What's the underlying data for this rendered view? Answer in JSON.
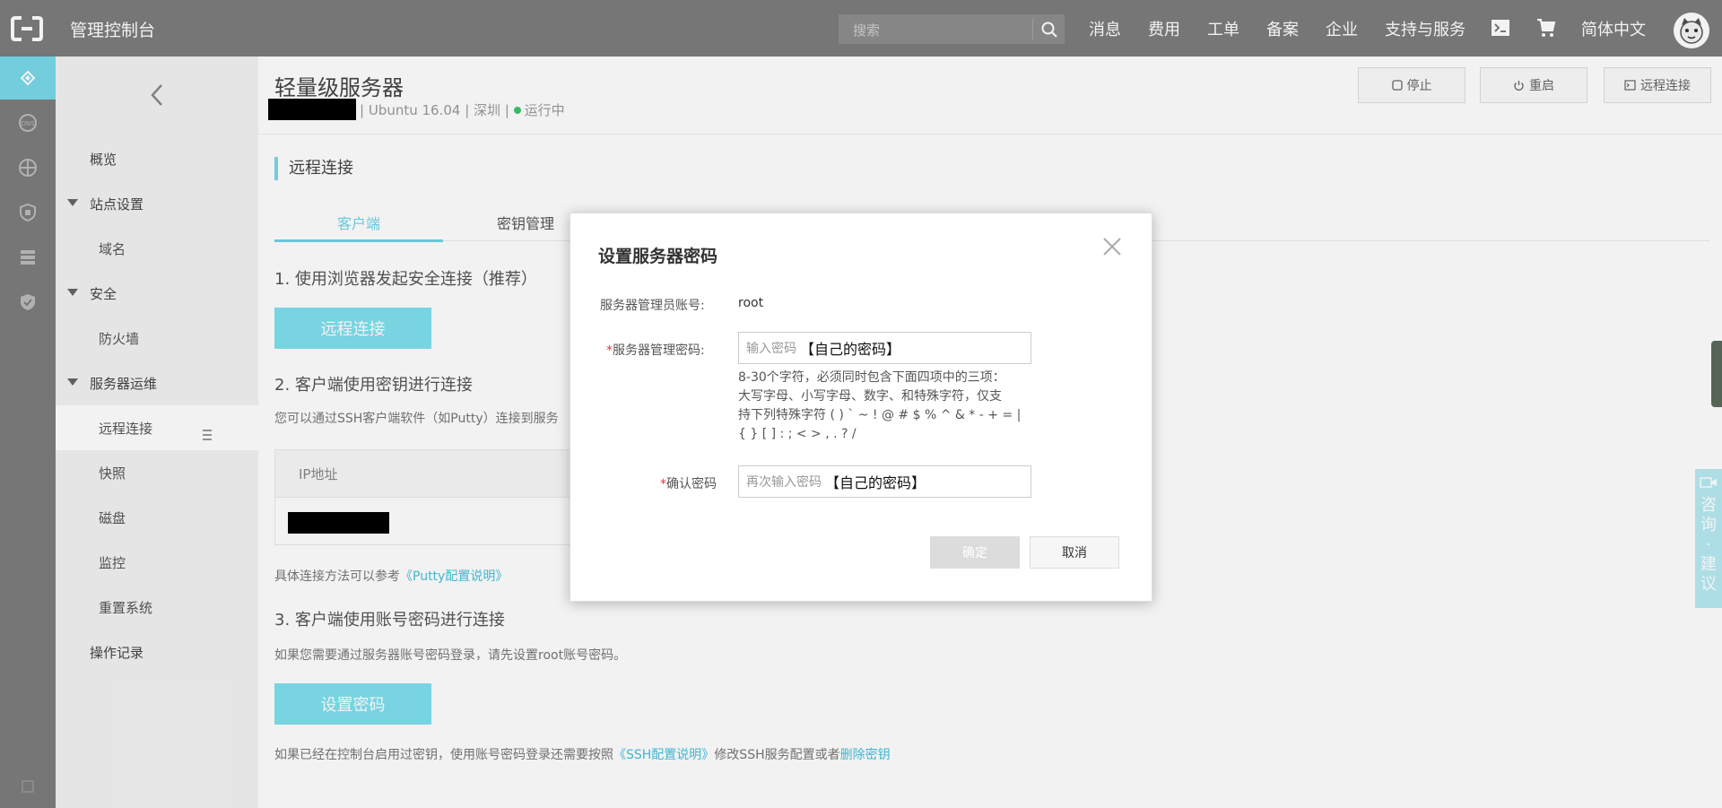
{
  "topbar": {
    "brand": "管理控制台",
    "search_placeholder": "搜索",
    "nav": [
      "消息",
      "费用",
      "工单",
      "备案",
      "企业",
      "支持与服务"
    ],
    "language": "简体中文"
  },
  "leftnav": {
    "items": [
      {
        "label": "概览"
      },
      {
        "label": "站点设置"
      },
      {
        "label": "域名"
      },
      {
        "label": "安全"
      },
      {
        "label": "防火墙"
      },
      {
        "label": "服务器运维"
      },
      {
        "label": "远程连接"
      },
      {
        "label": "快照"
      },
      {
        "label": "磁盘"
      },
      {
        "label": "监控"
      },
      {
        "label": "重置系统"
      },
      {
        "label": "操作记录"
      }
    ]
  },
  "header": {
    "title": "轻量级服务器",
    "os": "Ubuntu 16.04",
    "region": "深圳",
    "status": "运行中",
    "status_color": "#3ec46d",
    "buttons": {
      "stop": "停止",
      "restart": "重启",
      "remote": "远程连接"
    }
  },
  "section": {
    "title": "远程连接",
    "tabs": [
      "客户端",
      "密钥管理"
    ],
    "step1": "1. 使用浏览器发起安全连接（推荐）",
    "remote_btn": "远程连接",
    "step2": "2. 客户端使用密钥进行连接",
    "step2_desc": "您可以通过SSH客户端软件（如Putty）连接到服务",
    "table_header": "IP地址",
    "ref_prefix": "具体连接方法可以参考",
    "ref_link": "《Putty配置说明》",
    "step3": "3. 客户端使用账号密码进行连接",
    "step3_desc": "如果您需要通过服务器账号密码登录，请先设置root账号密码。",
    "set_pwd_btn": "设置密码",
    "note_prefix": "如果已经在控制台启用过密钥，使用账号密码登录还需要按照",
    "note_link1": "《SSH配置说明》",
    "note_mid": "修改SSH服务配置或者",
    "note_link2": "删除密钥"
  },
  "dialog": {
    "title": "设置服务器密码",
    "account_label": "服务器管理员账号:",
    "account_value": "root",
    "required_mark": "*",
    "password_label": "服务器管理密码:",
    "password_placeholder": "输入密码",
    "password_typed": "【自己的密码】",
    "hint_lines": [
      "8-30个字符，必须同时包含下面四项中的三项：",
      "大写字母、小写字母、数字、和特殊字符，仅支",
      "持下列特殊字符 ( ) ` ~ ! @ # $ % ^ & * - + = |",
      "{ } [ ] : ; < > , . ? /"
    ],
    "confirm_label": "确认密码",
    "confirm_placeholder": "再次输入密码",
    "confirm_typed": "【自己的密码】",
    "ok": "确定",
    "cancel": "取消"
  },
  "float_widget": {
    "text": "咨询·建议"
  },
  "colors": {
    "accent": "#79d8e9",
    "topbar": "#7d7d7d",
    "link": "#45c0dc"
  }
}
